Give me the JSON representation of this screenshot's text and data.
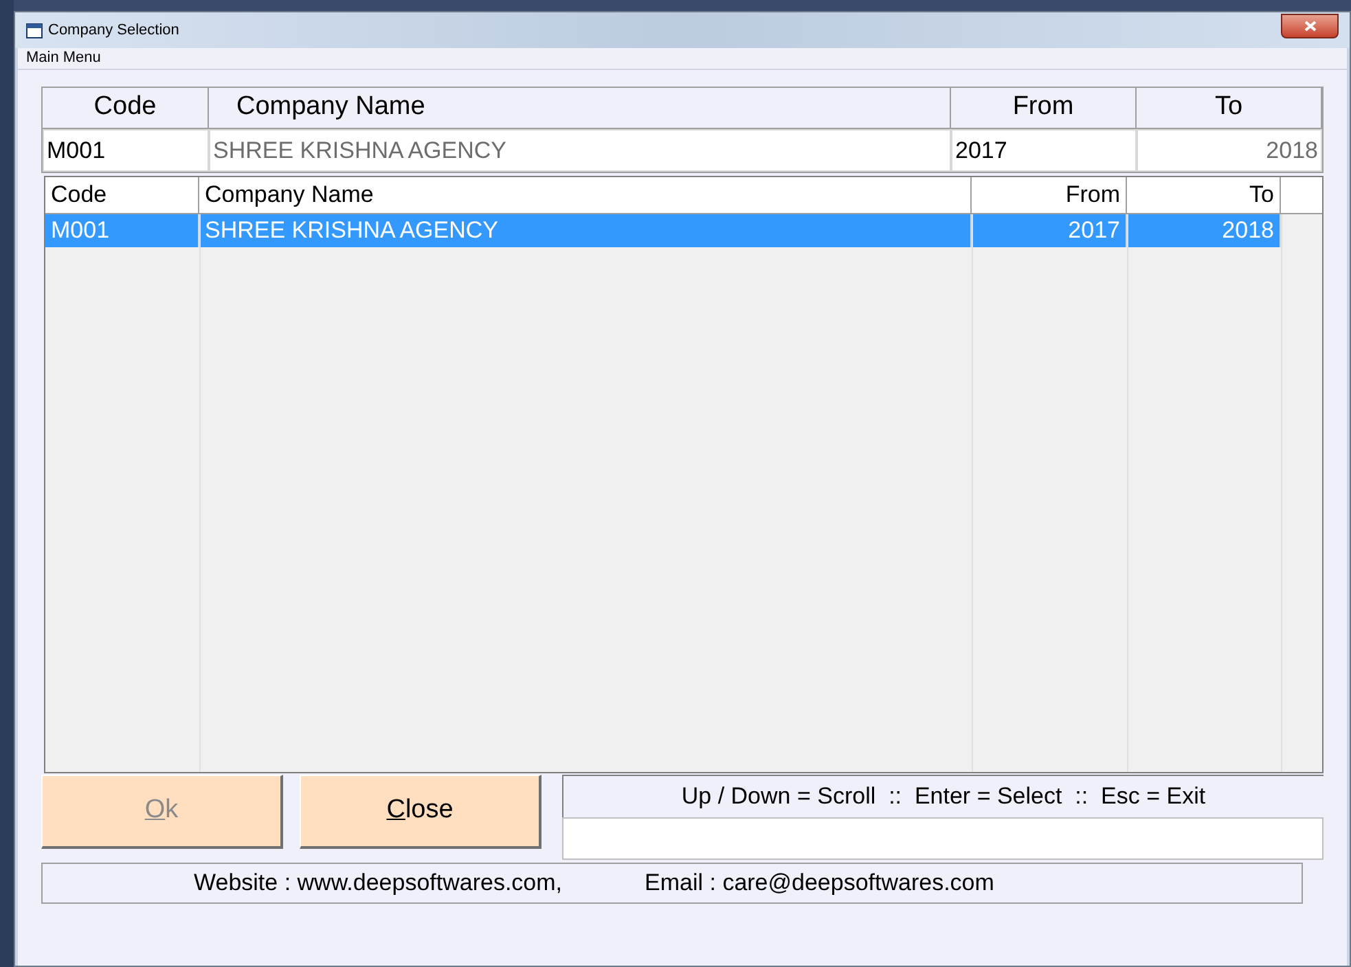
{
  "window": {
    "title": "Company Selection"
  },
  "menu": [
    "Main Menu"
  ],
  "header": {
    "columns": [
      "Code",
      "Company Name",
      "From",
      "To"
    ],
    "fields": {
      "code": "M001",
      "company_name": "SHREE KRISHNA AGENCY",
      "from": "2017",
      "to": "2018"
    }
  },
  "grid": {
    "columns": [
      "Code",
      "Company Name",
      "From",
      "To"
    ],
    "rows": [
      {
        "cells": [
          "M001",
          "SHREE KRISHNA AGENCY",
          "2017",
          "2018"
        ],
        "selected": true
      }
    ]
  },
  "buttons": [
    {
      "label": "Ok",
      "disabled": true,
      "access_key_underlined": true
    },
    {
      "label": "Close",
      "disabled": false,
      "access_key_underlined": true
    }
  ],
  "hint": "Up / Down = Scroll  ::  Enter = Select  ::  Esc = Exit",
  "footer": {
    "website": "Website : www.deepsoftwares.com,",
    "email": "Email : care@deepsoftwares.com"
  }
}
